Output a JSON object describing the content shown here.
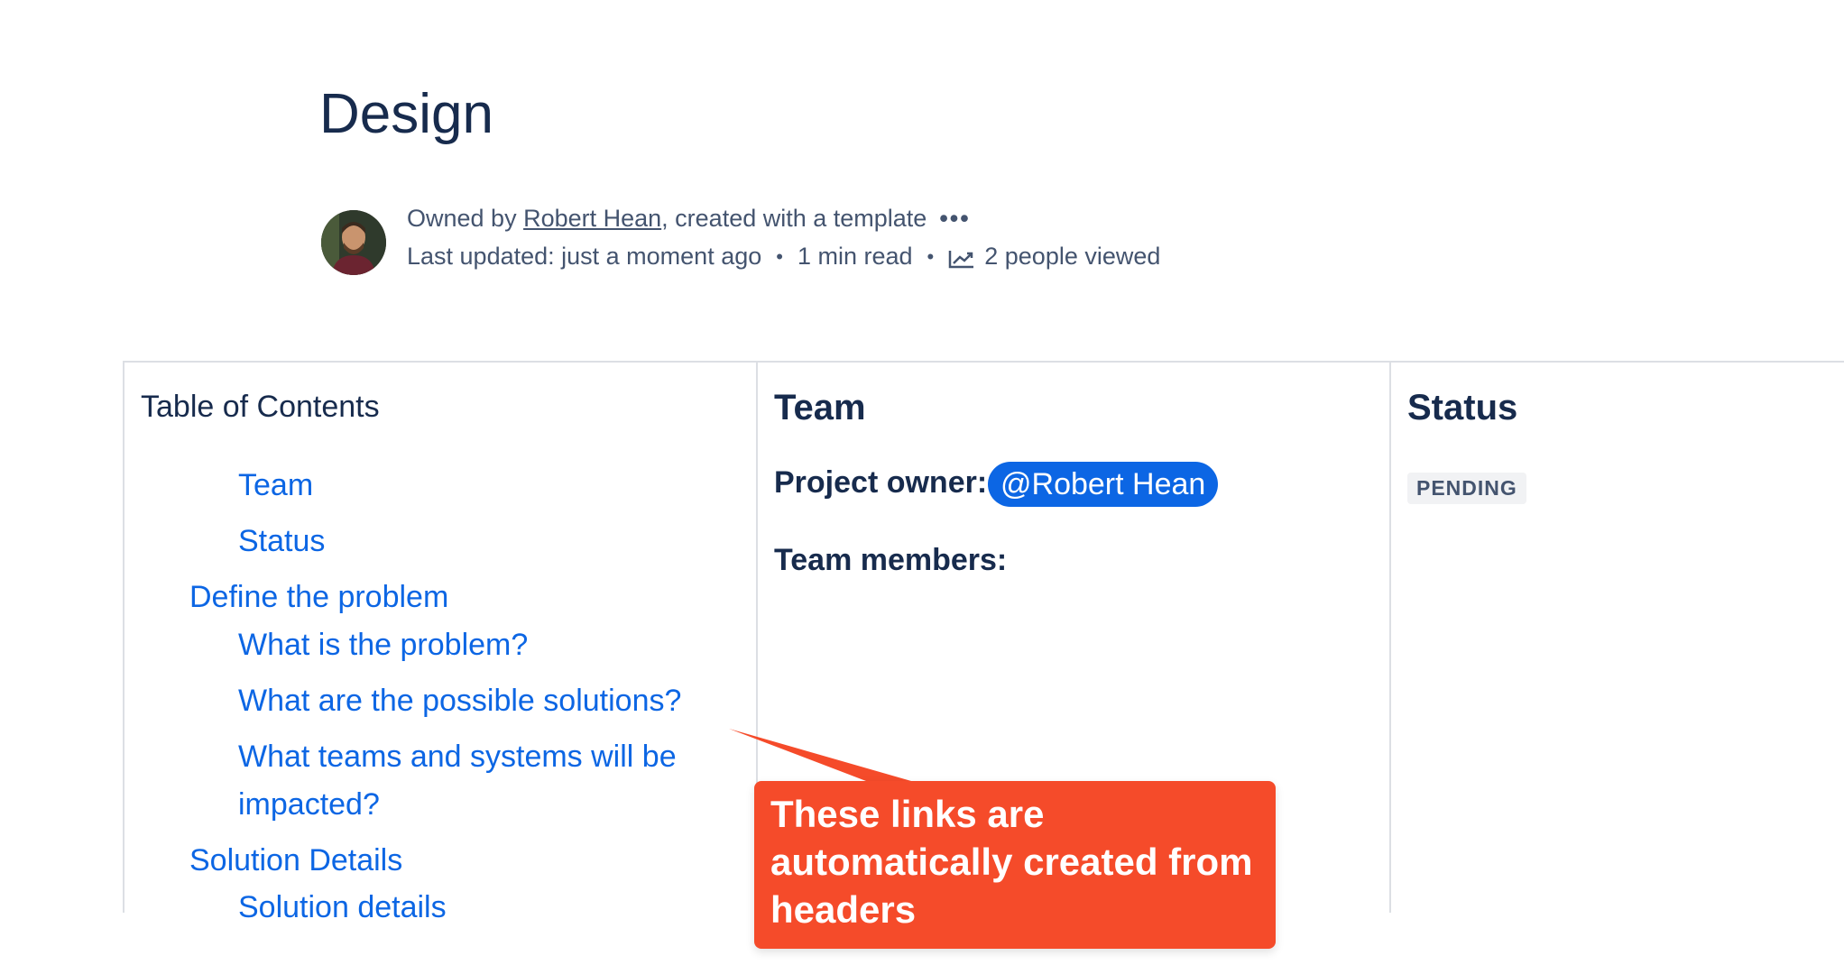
{
  "page": {
    "title": "Design"
  },
  "byline": {
    "owned_prefix": "Owned by ",
    "owner_name": "Robert Hean",
    "owned_suffix": ", created with a template",
    "more_icon": "more-horizontal-icon",
    "last_updated": "Last updated: just a moment ago",
    "read_time": "1 min read",
    "views": "2 people viewed",
    "views_icon": "analytics-trend-icon"
  },
  "toc": {
    "heading": "Table of Contents",
    "items": [
      {
        "label": "Team",
        "level": 2
      },
      {
        "label": "Status",
        "level": 2
      },
      {
        "label": "Define the problem",
        "level": 1
      },
      {
        "label": "What is the problem?",
        "level": 2
      },
      {
        "label": "What are the possible solutions?",
        "level": 2
      },
      {
        "label": "What teams and systems will be",
        "level": 2
      },
      {
        "label": "impacted?",
        "level": 2
      },
      {
        "label": "Solution Details",
        "level": 1
      },
      {
        "label": "Solution details",
        "level": 2
      }
    ]
  },
  "team": {
    "heading": "Team",
    "owner_label": "Project owner:",
    "owner_mention": "@Robert Hean",
    "members_label": "Team members:"
  },
  "status": {
    "heading": "Status",
    "lozenge": "PENDING"
  },
  "callout": {
    "line1": "These links are",
    "line2": "automatically created from",
    "line3": "headers"
  },
  "colors": {
    "link": "#0c66e4",
    "text": "#172b4d",
    "subtle": "#44546f",
    "callout": "#f54b2a",
    "mention_bg": "#0c66e4"
  }
}
